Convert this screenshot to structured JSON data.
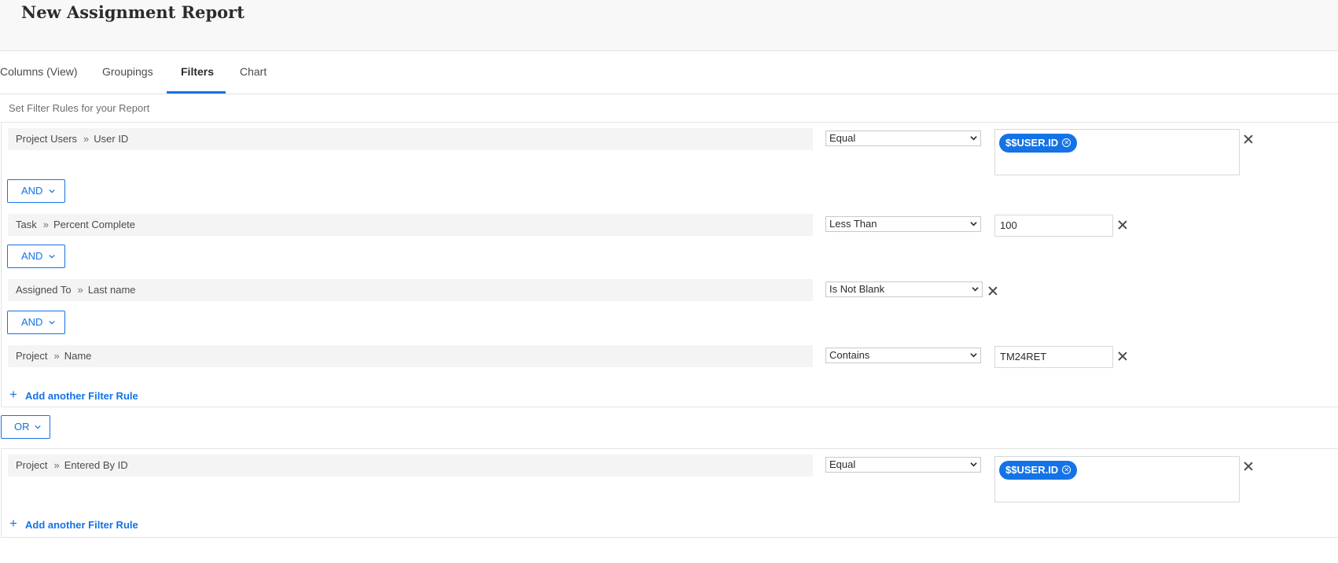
{
  "header": {
    "title": "New Assignment Report"
  },
  "tabs": [
    {
      "label": "Columns (View)",
      "active": false
    },
    {
      "label": "Groupings",
      "active": false
    },
    {
      "label": "Filters",
      "active": true
    },
    {
      "label": "Chart",
      "active": false
    }
  ],
  "instructions": "Set Filter Rules for your Report",
  "groups": [
    {
      "rules": [
        {
          "object": "Project Users",
          "field": "User ID",
          "operator": "Equal",
          "value_type": "tag",
          "value": "$$USER.ID"
        },
        {
          "object": "Task",
          "field": "Percent Complete",
          "operator": "Less Than",
          "value_type": "text",
          "value": "100"
        },
        {
          "object": "Assigned To",
          "field": "Last name",
          "operator": "Is Not Blank",
          "value_type": "none",
          "value": ""
        },
        {
          "object": "Project",
          "field": "Name",
          "operator": "Contains",
          "value_type": "text",
          "value": "TM24RET"
        }
      ],
      "connectors": [
        "AND",
        "AND",
        "AND"
      ],
      "add_rule_label": "Add another Filter Rule"
    },
    {
      "rules": [
        {
          "object": "Project",
          "field": "Entered By ID",
          "operator": "Equal",
          "value_type": "tag",
          "value": "$$USER.ID"
        }
      ],
      "connectors": [],
      "add_rule_label": "Add another Filter Rule"
    }
  ],
  "group_connector": "OR",
  "icons": {
    "separator": "double-chevron-right-icon",
    "remove": "close-icon",
    "dropdown": "chevron-down-icon",
    "add": "plus-icon",
    "tag_remove": "circle-x-icon"
  },
  "colors": {
    "accent": "#1473e6",
    "header_bg": "#f8f8f8",
    "field_bg": "#f4f4f4",
    "text": "#4b4b4b"
  }
}
